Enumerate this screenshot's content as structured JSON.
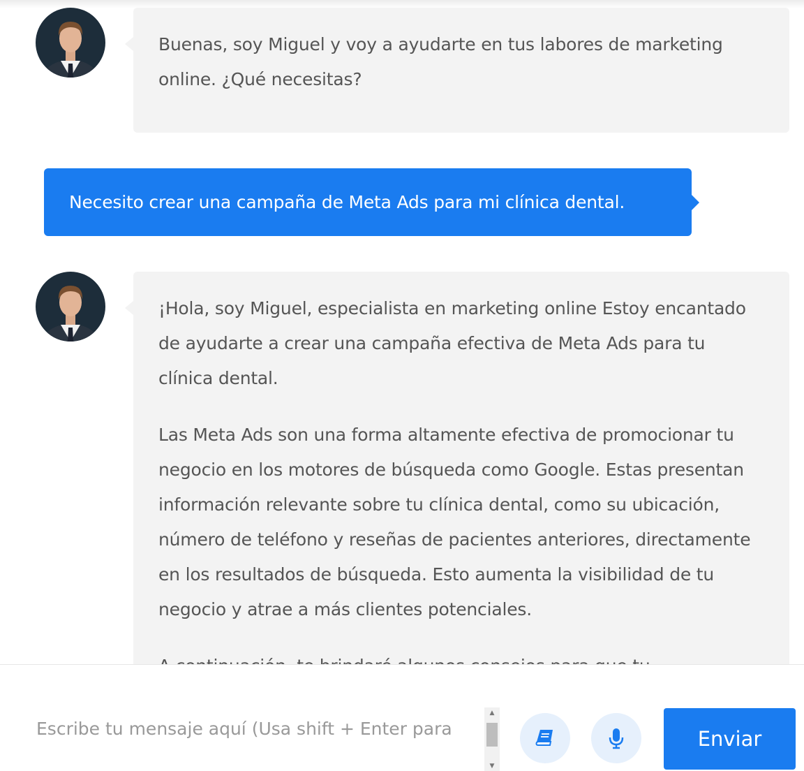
{
  "colors": {
    "accent": "#1a7cf0",
    "bot_bubble_bg": "#f3f3f3",
    "text": "#555555",
    "icon_button_bg": "#e6f0fc"
  },
  "messages": [
    {
      "role": "assistant",
      "avatar": "assistant-avatar-photo",
      "paragraphs": [
        "Buenas, soy Miguel y voy a ayudarte en tus labores de marketing online. ¿Qué necesitas?"
      ]
    },
    {
      "role": "user",
      "text": "Necesito crear una campaña de Meta Ads para mi clínica dental."
    },
    {
      "role": "assistant",
      "avatar": "assistant-avatar-photo",
      "paragraphs": [
        "¡Hola, soy Miguel, especialista en marketing online Estoy encantado de ayudarte a crear una campaña efectiva de Meta Ads para tu clínica dental.",
        "Las Meta Ads son una forma altamente efectiva de promocionar tu negocio en los motores de búsqueda como Google. Estas presentan información relevante sobre tu clínica dental, como su ubicación, número de teléfono y reseñas de pacientes anteriores, directamente en los resultados de búsqueda. Esto aumenta la visibilidad de tu negocio y atrae a más clientes potenciales.",
        "A continuación, te brindaré algunos consejos para que tu"
      ]
    }
  ],
  "composer": {
    "placeholder": "Escribe tu mensaje aquí (Usa shift + Enter para",
    "value": "",
    "book_icon": "book-icon",
    "mic_icon": "microphone-icon",
    "send_label": "Enviar"
  }
}
